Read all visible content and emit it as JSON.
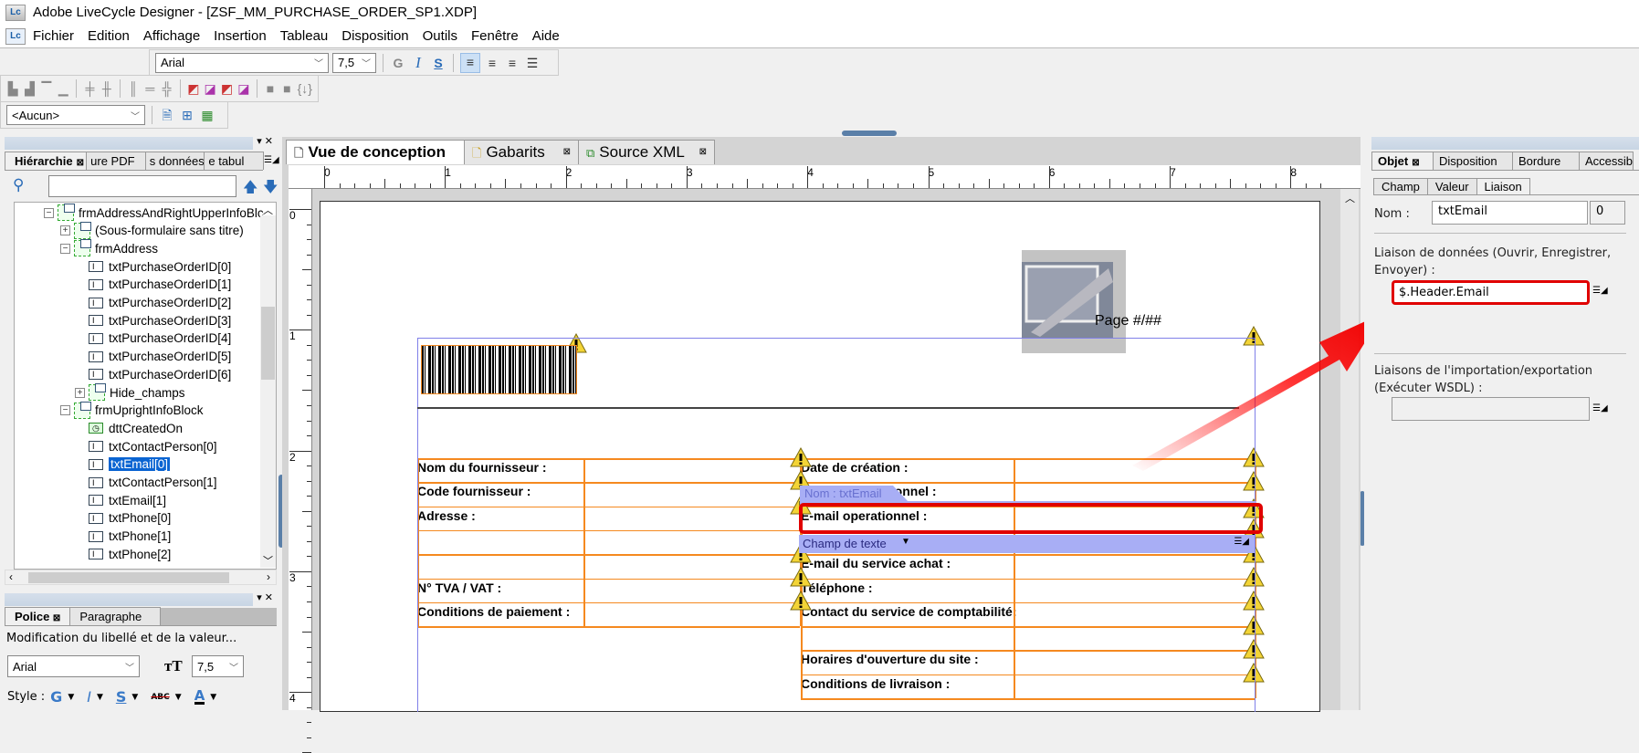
{
  "window": {
    "title": "Adobe LiveCycle Designer - [ZSF_MM_PURCHASE_ORDER_SP1.XDP]",
    "logo": "Lc"
  },
  "menu": [
    "Fichier",
    "Edition",
    "Affichage",
    "Insertion",
    "Tableau",
    "Disposition",
    "Outils",
    "Fenêtre",
    "Aide"
  ],
  "toolbar": {
    "font": "Arial",
    "size": "7,5",
    "bold": "G",
    "italic": "I",
    "underline": "S",
    "script_select": "<Aucun>"
  },
  "hierarchy": {
    "tabs": [
      "Hiérarchie",
      "ure PDF",
      "s données",
      "e tabul"
    ],
    "search_value": "",
    "items": [
      {
        "label": "frmAddressAndRightUpperInfoBlc",
        "level": 0,
        "type": "subform",
        "expand": "-"
      },
      {
        "label": "(Sous-formulaire sans titre)",
        "level": 1,
        "type": "subform",
        "expand": "+"
      },
      {
        "label": "frmAddress",
        "level": 1,
        "type": "subform",
        "expand": "-"
      },
      {
        "label": "txtPurchaseOrderID[0]",
        "level": 2,
        "type": "field"
      },
      {
        "label": "txtPurchaseOrderID[1]",
        "level": 2,
        "type": "field"
      },
      {
        "label": "txtPurchaseOrderID[2]",
        "level": 2,
        "type": "field"
      },
      {
        "label": "txtPurchaseOrderID[3]",
        "level": 2,
        "type": "field"
      },
      {
        "label": "txtPurchaseOrderID[4]",
        "level": 2,
        "type": "field"
      },
      {
        "label": "txtPurchaseOrderID[5]",
        "level": 2,
        "type": "field"
      },
      {
        "label": "txtPurchaseOrderID[6]",
        "level": 2,
        "type": "field"
      },
      {
        "label": "Hide_champs",
        "level": 2,
        "type": "subform",
        "expand": "+"
      },
      {
        "label": "frmUprightInfoBlock",
        "level": 1,
        "type": "subform",
        "expand": "-"
      },
      {
        "label": "dttCreatedOn",
        "level": 2,
        "type": "date"
      },
      {
        "label": "txtContactPerson[0]",
        "level": 2,
        "type": "field"
      },
      {
        "label": "txtEmail[0]",
        "level": 2,
        "type": "field",
        "selected": true
      },
      {
        "label": "txtContactPerson[1]",
        "level": 2,
        "type": "field"
      },
      {
        "label": "txtEmail[1]",
        "level": 2,
        "type": "field"
      },
      {
        "label": "txtPhone[0]",
        "level": 2,
        "type": "field"
      },
      {
        "label": "txtPhone[1]",
        "level": 2,
        "type": "field"
      },
      {
        "label": "txtPhone[2]",
        "level": 2,
        "type": "field"
      }
    ]
  },
  "font_panel": {
    "tabs": [
      "Police",
      "Paragraphe"
    ],
    "description": "Modification du libellé et de la valeur...",
    "font": "Arial",
    "size": "7,5",
    "style_label": "Style :",
    "bold": "G",
    "italic": "I",
    "underline": "S",
    "strike": "ABC",
    "color": "A"
  },
  "editor": {
    "tabs": [
      "Vue de conception",
      "Gabarits",
      "Source XML"
    ],
    "ruler_h": [
      "0",
      "1",
      "2",
      "3",
      "4",
      "5",
      "6",
      "7",
      "8"
    ],
    "ruler_v": [
      "0",
      "1",
      "2",
      "3",
      "4"
    ],
    "page_number": "Page  #/##",
    "left_labels": [
      "Nom du fournisseur :",
      "Code fournisseur :",
      "Adresse :",
      "",
      "",
      "N° TVA / VAT :",
      "Conditions de paiement :"
    ],
    "right_labels": [
      "Date de création :",
      "Contact opérationnel :",
      "E-mail operationnel :",
      "",
      "E-mail du service achat :",
      "Téléphone :",
      "Contact du service de comptabilité:",
      "",
      "Horaires d'ouverture du site :",
      "Conditions de livraison :"
    ],
    "selection_name": "Nom : txtEmail",
    "selection_type": "Champ de texte"
  },
  "object_panel": {
    "tabs": [
      "Objet",
      "Disposition",
      "Bordure",
      "Accessibi"
    ],
    "subtabs": [
      "Champ",
      "Valeur",
      "Liaison"
    ],
    "name_label": "Nom :",
    "name_value": "txtEmail",
    "index_value": "0",
    "binding_label": "Liaison de données (Ouvrir, Enregistrer, Envoyer) :",
    "binding_value": "$.Header.Email",
    "import_label": "Liaisons de l'importation/exportation (Exécuter WSDL) :",
    "import_value": ""
  },
  "colors": {
    "accent": "#0a64d2",
    "highlight": "#e00000",
    "table_line": "#f5891f",
    "selection": "#a8aef5"
  }
}
